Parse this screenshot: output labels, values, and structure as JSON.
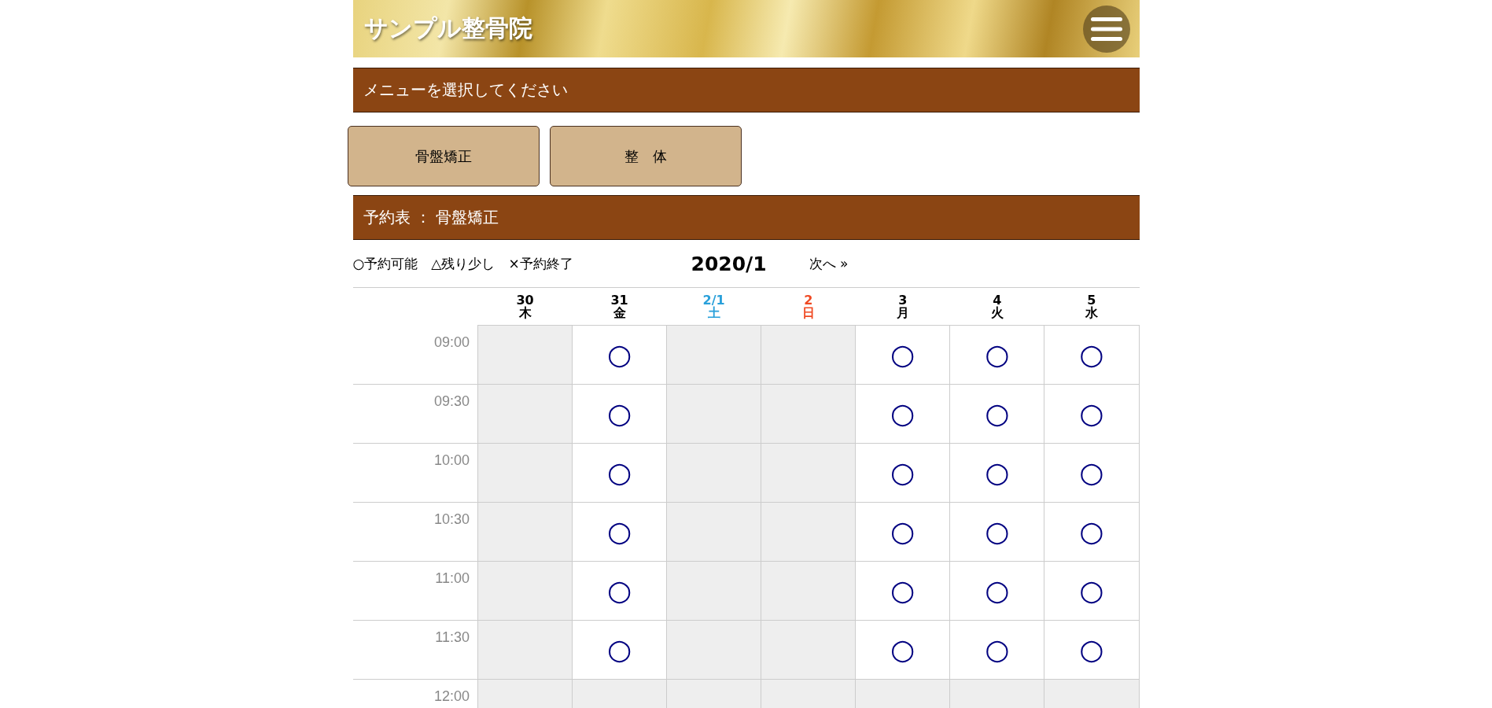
{
  "header": {
    "title": "サンプル整骨院"
  },
  "menu_heading": "メニューを選択してください",
  "menu_buttons": [
    {
      "label": "骨盤矯正"
    },
    {
      "label": "整　体"
    }
  ],
  "schedule_heading": "予約表 ： 骨盤矯正",
  "legend": "○予約可能　△残り少し　×予約終了",
  "month": "2020/1",
  "next_link": "次へ »",
  "days": [
    {
      "date": "30",
      "weekday": "木",
      "color": "#000000"
    },
    {
      "date": "31",
      "weekday": "金",
      "color": "#000000"
    },
    {
      "date": "2/1",
      "weekday": "土",
      "color": "#29a0da"
    },
    {
      "date": "2",
      "weekday": "日",
      "color": "#f04a23"
    },
    {
      "date": "3",
      "weekday": "月",
      "color": "#000000"
    },
    {
      "date": "4",
      "weekday": "火",
      "color": "#000000"
    },
    {
      "date": "5",
      "weekday": "水",
      "color": "#000000"
    }
  ],
  "rows": [
    {
      "time": "09:00",
      "cells": [
        {
          "kind": "closed"
        },
        {
          "kind": "open",
          "mark": "○"
        },
        {
          "kind": "closed"
        },
        {
          "kind": "closed"
        },
        {
          "kind": "open",
          "mark": "○"
        },
        {
          "kind": "open",
          "mark": "○"
        },
        {
          "kind": "open",
          "mark": "○"
        }
      ]
    },
    {
      "time": "09:30",
      "cells": [
        {
          "kind": "closed"
        },
        {
          "kind": "open",
          "mark": "○"
        },
        {
          "kind": "closed"
        },
        {
          "kind": "closed"
        },
        {
          "kind": "open",
          "mark": "○"
        },
        {
          "kind": "open",
          "mark": "○"
        },
        {
          "kind": "open",
          "mark": "○"
        }
      ]
    },
    {
      "time": "10:00",
      "cells": [
        {
          "kind": "closed"
        },
        {
          "kind": "open",
          "mark": "○"
        },
        {
          "kind": "closed"
        },
        {
          "kind": "closed"
        },
        {
          "kind": "open",
          "mark": "○"
        },
        {
          "kind": "open",
          "mark": "○"
        },
        {
          "kind": "open",
          "mark": "○"
        }
      ]
    },
    {
      "time": "10:30",
      "cells": [
        {
          "kind": "closed"
        },
        {
          "kind": "open",
          "mark": "○"
        },
        {
          "kind": "closed"
        },
        {
          "kind": "closed"
        },
        {
          "kind": "open",
          "mark": "○"
        },
        {
          "kind": "open",
          "mark": "○"
        },
        {
          "kind": "open",
          "mark": "○"
        }
      ]
    },
    {
      "time": "11:00",
      "cells": [
        {
          "kind": "closed"
        },
        {
          "kind": "open",
          "mark": "○"
        },
        {
          "kind": "closed"
        },
        {
          "kind": "closed"
        },
        {
          "kind": "open",
          "mark": "○"
        },
        {
          "kind": "open",
          "mark": "○"
        },
        {
          "kind": "open",
          "mark": "○"
        }
      ]
    },
    {
      "time": "11:30",
      "cells": [
        {
          "kind": "closed"
        },
        {
          "kind": "open",
          "mark": "○"
        },
        {
          "kind": "closed"
        },
        {
          "kind": "closed"
        },
        {
          "kind": "open",
          "mark": "○"
        },
        {
          "kind": "open",
          "mark": "○"
        },
        {
          "kind": "open",
          "mark": "○"
        }
      ]
    },
    {
      "time": "12:00",
      "cells": [
        {
          "kind": "closed"
        },
        {
          "kind": "closed"
        },
        {
          "kind": "closed"
        },
        {
          "kind": "closed"
        },
        {
          "kind": "closed"
        },
        {
          "kind": "closed"
        },
        {
          "kind": "closed"
        }
      ]
    }
  ]
}
